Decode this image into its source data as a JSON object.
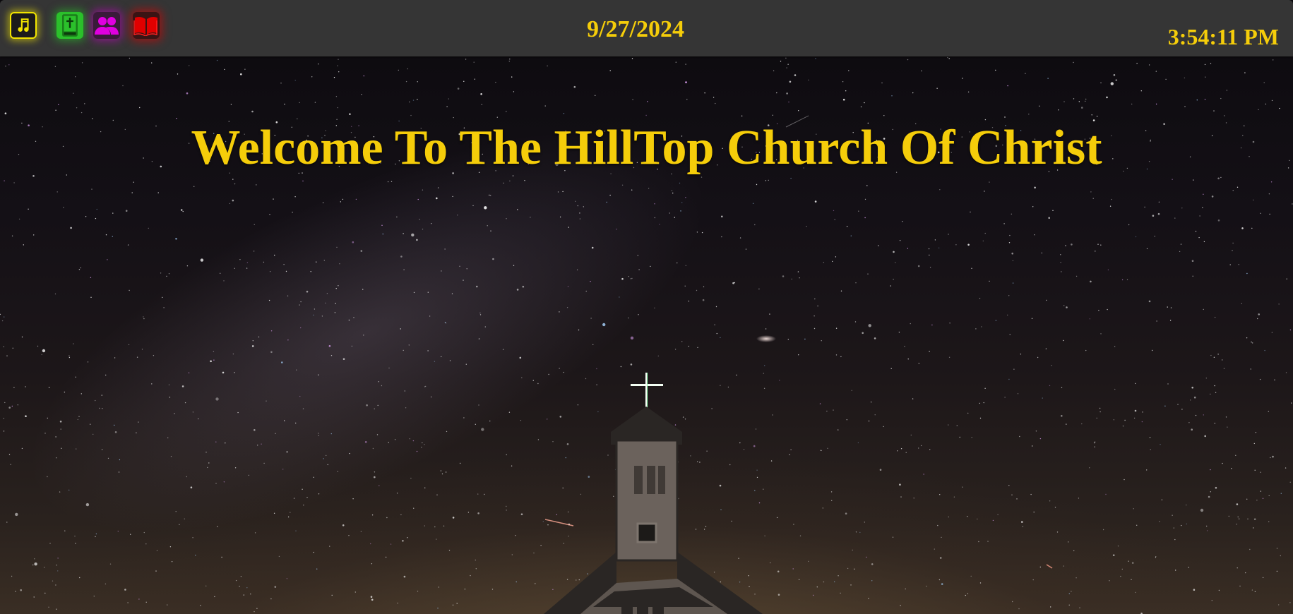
{
  "header": {
    "date": "9/27/2024",
    "time": "3:54:11 PM",
    "nav_icons": [
      {
        "name": "music-icon",
        "color": "#f2e500"
      },
      {
        "name": "bible-icon",
        "color": "#2bc02b"
      },
      {
        "name": "people-icon",
        "color": "#e000e0"
      },
      {
        "name": "open-book-icon",
        "color": "#e00000"
      }
    ]
  },
  "main": {
    "welcome_text": "Welcome To The HillTop Church Of Christ",
    "background": "starry-night-church-photo"
  },
  "colors": {
    "accent_text": "#f5cd0a",
    "topbar": "#353535"
  }
}
